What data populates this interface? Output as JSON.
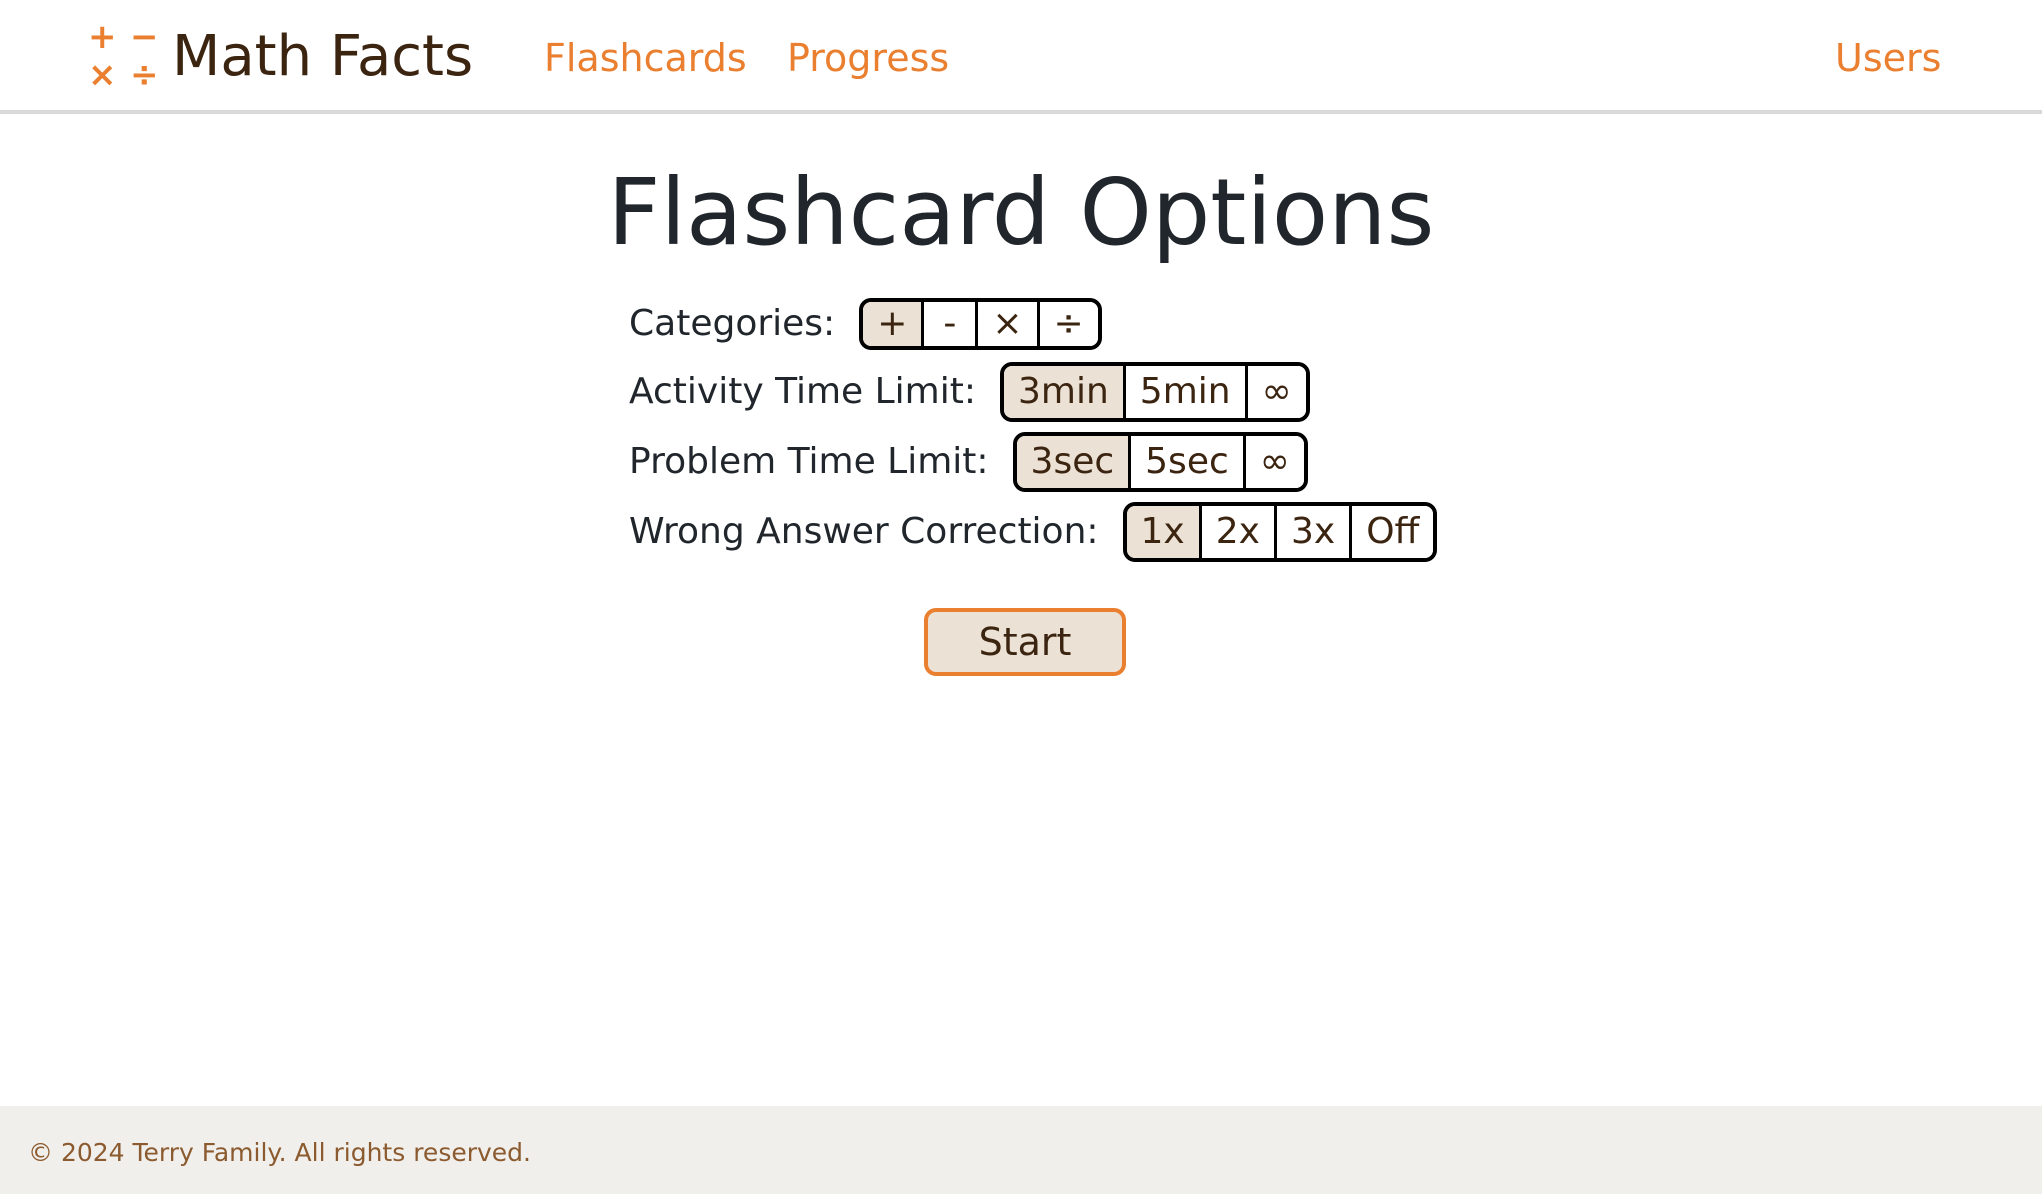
{
  "brand": {
    "name": "Math Facts",
    "logo_symbols": {
      "plus": "+",
      "minus": "−",
      "times": "×",
      "divide": "÷"
    },
    "accent_color": "#ea7f30",
    "text_color": "#3b2410"
  },
  "nav": {
    "flashcards": "Flashcards",
    "progress": "Progress",
    "users": "Users"
  },
  "main": {
    "title": "Flashcard Options",
    "options": {
      "categories": {
        "label": "Categories:",
        "choices": [
          "+",
          "-",
          "×",
          "÷"
        ],
        "selected": [
          "+"
        ]
      },
      "activity_time_limit": {
        "label": "Activity Time Limit:",
        "choices": [
          "3min",
          "5min",
          "∞"
        ],
        "selected": "3min"
      },
      "problem_time_limit": {
        "label": "Problem Time Limit:",
        "choices": [
          "3sec",
          "5sec",
          "∞"
        ],
        "selected": "3sec"
      },
      "wrong_answer_correction": {
        "label": "Wrong Answer Correction:",
        "choices": [
          "1x",
          "2x",
          "3x",
          "Off"
        ],
        "selected": "1x"
      }
    },
    "start_label": "Start",
    "selected_color": "#ebe1d5"
  },
  "footer": {
    "copyright": "© 2024 Terry Family. All rights reserved."
  }
}
